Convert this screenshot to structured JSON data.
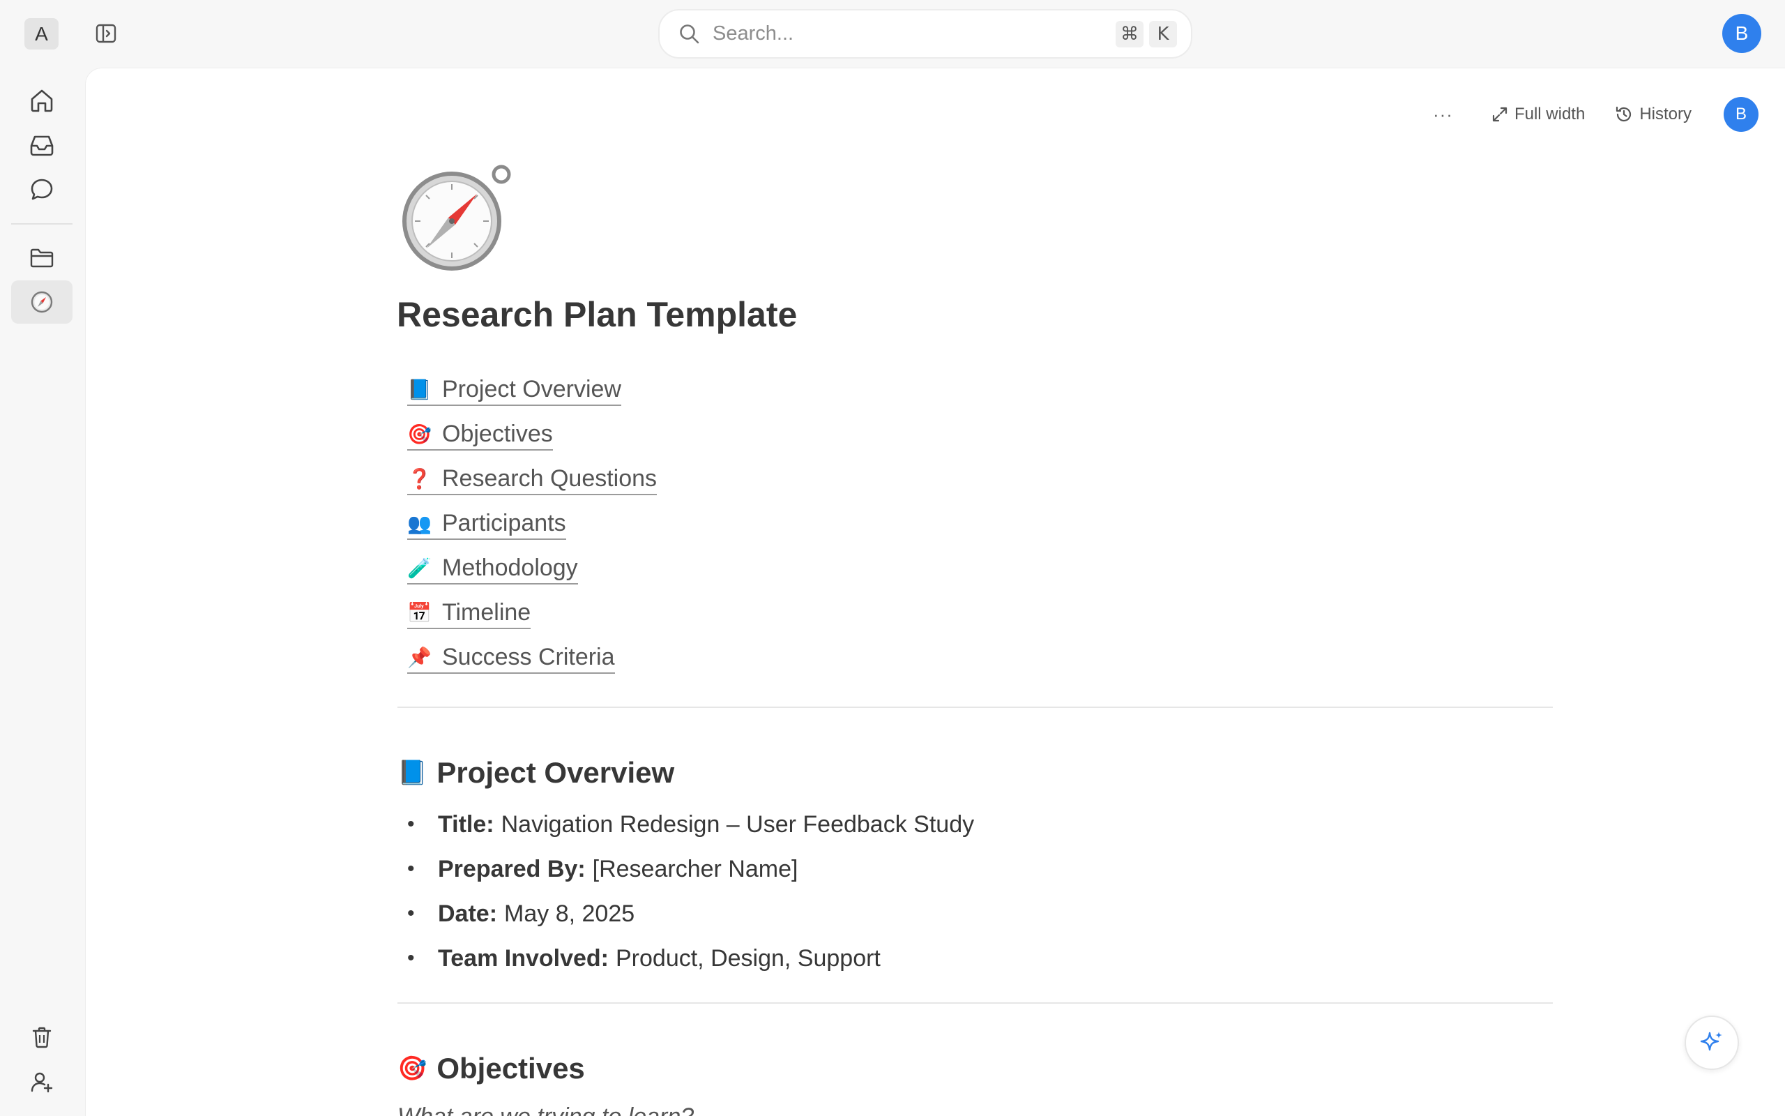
{
  "workspace": {
    "initial": "A"
  },
  "search": {
    "placeholder": "Search...",
    "shortcut_mod": "⌘",
    "shortcut_key": "K"
  },
  "user": {
    "initial": "B",
    "color": "#2f80ed"
  },
  "sidebar": {
    "items": [
      {
        "icon": "home-icon"
      },
      {
        "icon": "inbox-icon"
      },
      {
        "icon": "chat-icon"
      },
      {
        "icon": "folder-icon"
      },
      {
        "icon": "compass-icon",
        "active": true
      }
    ],
    "bottom": [
      {
        "icon": "trash-icon"
      },
      {
        "icon": "add-user-icon"
      }
    ]
  },
  "toolbar": {
    "more_label": "···",
    "full_width_label": "Full width",
    "history_label": "History"
  },
  "page": {
    "icon": "compass-icon",
    "title": "Research Plan Template",
    "toc": [
      {
        "emoji": "📘",
        "label": "Project Overview"
      },
      {
        "emoji": "🎯",
        "label": "Objectives"
      },
      {
        "emoji": "❓",
        "label": "Research Questions"
      },
      {
        "emoji": "👥",
        "label": "Participants"
      },
      {
        "emoji": "🧪",
        "label": "Methodology"
      },
      {
        "emoji": "📅",
        "label": "Timeline"
      },
      {
        "emoji": "📌",
        "label": "Success Criteria"
      }
    ],
    "sections": {
      "overview": {
        "emoji": "📘",
        "heading": "Project Overview",
        "items": [
          {
            "label": "Title:",
            "value": "Navigation Redesign – User Feedback Study"
          },
          {
            "label": "Prepared By:",
            "value": "[Researcher Name]"
          },
          {
            "label": "Date:",
            "value": "May 8, 2025"
          },
          {
            "label": "Team Involved:",
            "value": "Product, Design, Support"
          }
        ]
      },
      "objectives": {
        "emoji": "🎯",
        "heading": "Objectives",
        "subtext": "What are we trying to learn?"
      }
    }
  }
}
